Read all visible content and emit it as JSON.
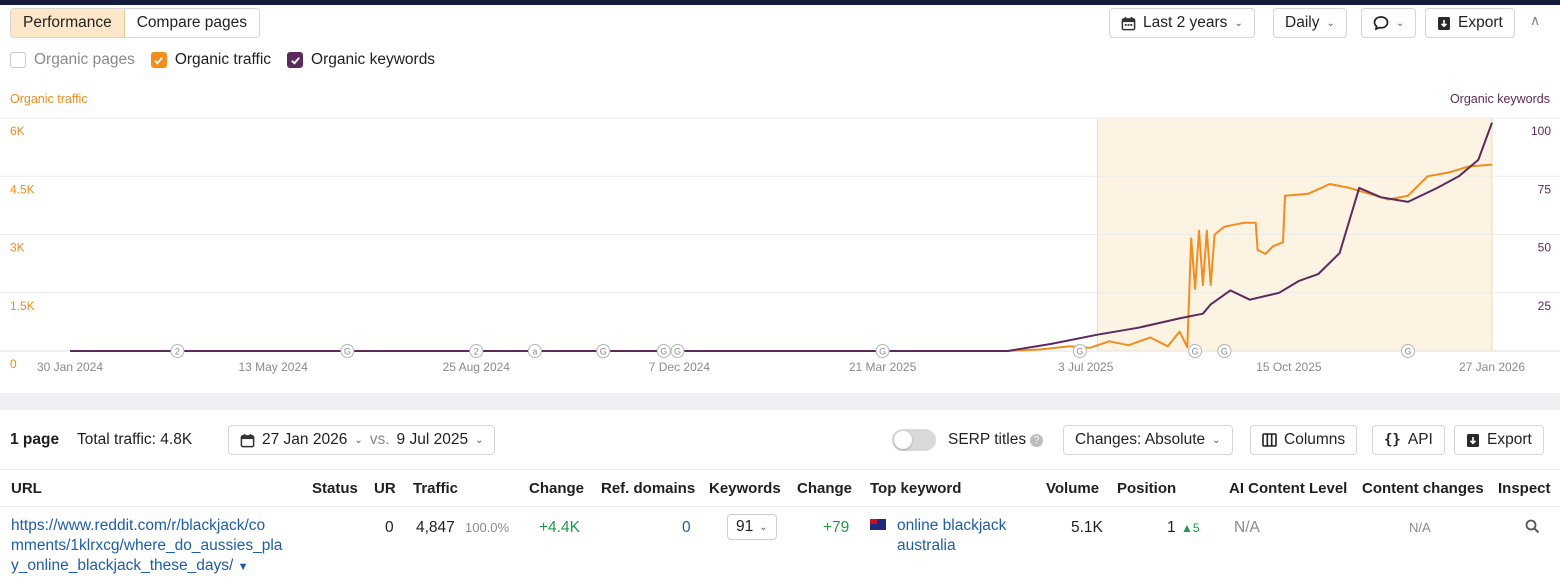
{
  "toolbar": {
    "tabs": [
      "Performance",
      "Compare pages"
    ],
    "date_range": "Last 2 years",
    "granularity": "Daily",
    "export": "Export"
  },
  "legend": {
    "organic_pages": "Organic pages",
    "organic_traffic": "Organic traffic",
    "organic_keywords": "Organic keywords"
  },
  "colors": {
    "traffic": "#f28c1c",
    "keywords": "#5d2a5e",
    "accent_tab": "#fde7c8",
    "link": "#1d5ea8",
    "positive": "#1e9a4a"
  },
  "chart_data": {
    "type": "line",
    "left_axis_title": "Organic traffic",
    "right_axis_title": "Organic keywords",
    "left_ticks": [
      "0",
      "1.5K",
      "3K",
      "4.5K",
      "6K"
    ],
    "right_ticks": [
      "25",
      "50",
      "75",
      "100"
    ],
    "x_ticks": [
      "30 Jan 2024",
      "13 May 2024",
      "25 Aug 2024",
      "7 Dec 2024",
      "21 Mar 2025",
      "3 Jul 2025",
      "15 Oct 2025",
      "27 Jan 2026"
    ],
    "x_range": [
      "2024-01-30",
      "2026-01-27"
    ],
    "ylim_left": [
      0,
      6000
    ],
    "ylim_right": [
      0,
      100
    ],
    "highlight_range": [
      "2025-07-09",
      "2026-01-27"
    ],
    "annotations": [
      {
        "date": "2024-03-25",
        "label": "2"
      },
      {
        "date": "2024-06-20",
        "label": "G"
      },
      {
        "date": "2024-08-25",
        "label": "2"
      },
      {
        "date": "2024-09-24",
        "label": "a"
      },
      {
        "date": "2024-10-29",
        "label": "G"
      },
      {
        "date": "2024-11-29",
        "label": "G"
      },
      {
        "date": "2024-12-06",
        "label": "G"
      },
      {
        "date": "2025-03-21",
        "label": "G"
      },
      {
        "date": "2025-06-30",
        "label": "G"
      },
      {
        "date": "2025-08-28",
        "label": "G"
      },
      {
        "date": "2025-09-12",
        "label": "G"
      },
      {
        "date": "2025-12-15",
        "label": "G"
      }
    ],
    "series": [
      {
        "name": "Organic traffic",
        "axis": "left",
        "points": [
          [
            "2024-01-30",
            0
          ],
          [
            "2025-05-24",
            0
          ],
          [
            "2025-06-10",
            40
          ],
          [
            "2025-06-25",
            120
          ],
          [
            "2025-07-05",
            80
          ],
          [
            "2025-07-15",
            250
          ],
          [
            "2025-07-25",
            150
          ],
          [
            "2025-08-05",
            350
          ],
          [
            "2025-08-14",
            120
          ],
          [
            "2025-08-20",
            500
          ],
          [
            "2025-08-24",
            100
          ],
          [
            "2025-08-26",
            2900
          ],
          [
            "2025-08-28",
            1600
          ],
          [
            "2025-08-30",
            3100
          ],
          [
            "2025-09-01",
            1700
          ],
          [
            "2025-09-03",
            3100
          ],
          [
            "2025-09-05",
            1700
          ],
          [
            "2025-09-07",
            3000
          ],
          [
            "2025-09-12",
            3200
          ],
          [
            "2025-09-22",
            3300
          ],
          [
            "2025-09-28",
            3300
          ],
          [
            "2025-09-29",
            2600
          ],
          [
            "2025-10-03",
            2500
          ],
          [
            "2025-10-07",
            2700
          ],
          [
            "2025-10-12",
            2800
          ],
          [
            "2025-10-13",
            4000
          ],
          [
            "2025-10-25",
            4050
          ],
          [
            "2025-11-05",
            4300
          ],
          [
            "2025-11-15",
            4200
          ],
          [
            "2025-11-25",
            4050
          ],
          [
            "2025-12-05",
            3900
          ],
          [
            "2025-12-15",
            4000
          ],
          [
            "2025-12-25",
            4500
          ],
          [
            "2026-01-05",
            4600
          ],
          [
            "2026-01-15",
            4750
          ],
          [
            "2026-01-27",
            4800
          ]
        ]
      },
      {
        "name": "Organic keywords",
        "axis": "right",
        "points": [
          [
            "2024-01-30",
            0
          ],
          [
            "2025-05-24",
            0
          ],
          [
            "2025-06-15",
            3
          ],
          [
            "2025-07-09",
            7
          ],
          [
            "2025-07-30",
            10
          ],
          [
            "2025-08-20",
            14
          ],
          [
            "2025-09-01",
            16
          ],
          [
            "2025-09-05",
            20
          ],
          [
            "2025-09-15",
            26
          ],
          [
            "2025-09-25",
            22
          ],
          [
            "2025-10-10",
            25
          ],
          [
            "2025-10-20",
            30
          ],
          [
            "2025-10-30",
            33
          ],
          [
            "2025-11-10",
            42
          ],
          [
            "2025-11-20",
            70
          ],
          [
            "2025-12-01",
            66
          ],
          [
            "2025-12-15",
            64
          ],
          [
            "2025-12-30",
            70
          ],
          [
            "2026-01-10",
            75
          ],
          [
            "2026-01-20",
            82
          ],
          [
            "2026-01-27",
            98
          ]
        ]
      }
    ]
  },
  "summary": {
    "pages": "1 page",
    "total_traffic": "Total traffic: 4.8K",
    "date_from": "27 Jan 2026",
    "vs": "vs.",
    "date_to": "9 Jul 2025",
    "serp_titles": "SERP titles",
    "changes": "Changes: Absolute",
    "columns": "Columns",
    "api": "API",
    "export": "Export"
  },
  "table": {
    "headers": [
      "URL",
      "Status",
      "UR",
      "Traffic",
      "Change",
      "Ref. domains",
      "Keywords",
      "Change",
      "Top keyword",
      "Volume",
      "Position",
      "AI Content Level",
      "Content changes",
      "Inspect"
    ],
    "row": {
      "url_line1": "https://www.reddit.com/r/blackjack/co",
      "url_line2": "mments/1klrxcg/where_do_aussies_pla",
      "url_line3": "y_online_blackjack_these_days/",
      "ur": "0",
      "traffic": "4,847",
      "traffic_share": "100.0%",
      "traffic_change": "+4.4K",
      "ref_domains": "0",
      "keywords": "91",
      "keywords_change": "+79",
      "top_keyword_line1": "online blackjack",
      "top_keyword_line2": "australia",
      "volume": "5.1K",
      "position": "1",
      "position_change": "5",
      "ai_content_level": "N/A",
      "content_changes": "N/A"
    }
  },
  "icons": [
    "calendar-icon",
    "chevron-down-icon",
    "comment-icon",
    "export-icon",
    "collapse-icon",
    "checkmark-icon",
    "help-icon",
    "columns-icon",
    "api-icon",
    "flag-au-icon",
    "search-icon",
    "arrow-up-icon"
  ]
}
